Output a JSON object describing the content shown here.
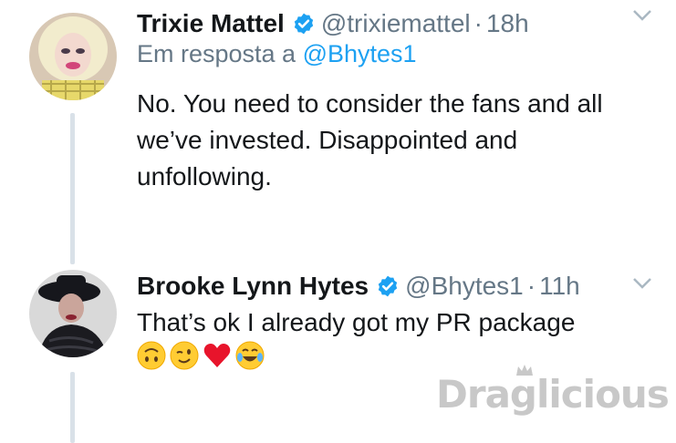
{
  "tweets": [
    {
      "name": "Trixie Mattel",
      "handle": "@trixiemattel",
      "separator": "·",
      "time": "18h",
      "reply_prefix": "Em resposta a",
      "reply_mention": "@Bhytes1",
      "text": "No. You need to consider the fans and all we’ve invested. Disappointed and unfollowing."
    },
    {
      "name": "Brooke Lynn Hytes",
      "handle": "@Bhytes1",
      "separator": "·",
      "time": "11h",
      "text": "That’s ok I already got my PR package",
      "emojis": [
        "upside-down-face",
        "winking-face",
        "red-heart",
        "tears-of-joy-face"
      ]
    }
  ],
  "watermark": "Draglicious",
  "colors": {
    "verified": "#1da1f2",
    "muted": "#657786",
    "thread_line": "#d9e1e8"
  }
}
